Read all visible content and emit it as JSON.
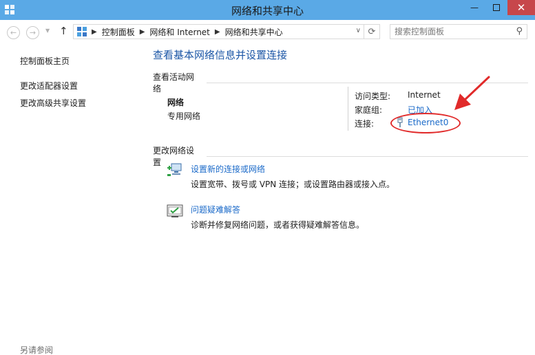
{
  "window": {
    "title": "网络和共享中心"
  },
  "toolbar": {
    "breadcrumbs": [
      "控制面板",
      "网络和 Internet",
      "网络和共享中心"
    ],
    "search_placeholder": "搜索控制面板"
  },
  "sidebar": {
    "home": "控制面板主页",
    "adapter_settings": "更改适配器设置",
    "advanced_sharing": "更改高级共享设置",
    "see_also": "另请参阅"
  },
  "main": {
    "title": "查看基本网络信息并设置连接",
    "active_networks_heading": "查看活动网络",
    "network": {
      "name": "网络",
      "type": "专用网络",
      "access_type_label": "访问类型:",
      "access_type_value": "Internet",
      "homegroup_label": "家庭组:",
      "homegroup_value": "已加入",
      "connections_label": "连接:",
      "connection_value": "Ethernet0"
    },
    "change_settings_heading": "更改网络设置",
    "tasks": [
      {
        "label": "设置新的连接或网络",
        "description": "设置宽带、拨号或 VPN 连接；或设置路由器或接入点。",
        "icon": "network-setup-icon"
      },
      {
        "label": "问题疑难解答",
        "description": "诊断并修复网络问题，或者获得疑难解答信息。",
        "icon": "troubleshoot-icon"
      }
    ]
  },
  "colors": {
    "titlebar": "#5aa9e6",
    "link": "#1b6ac9",
    "heading": "#1b56a6",
    "annotation": "#e12a2a",
    "close": "#c7474b"
  }
}
